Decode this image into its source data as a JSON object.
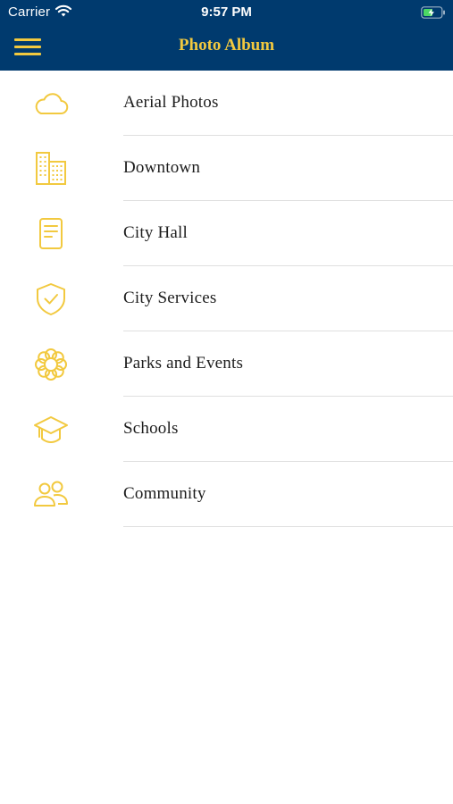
{
  "status_bar": {
    "carrier": "Carrier",
    "time": "9:57 PM",
    "wifi_icon": "wifi-icon",
    "battery_icon": "battery-charging-icon"
  },
  "nav": {
    "title": "Photo Album",
    "menu_icon": "hamburger-menu-icon"
  },
  "colors": {
    "nav_background": "#003a6e",
    "accent": "#f2c93f",
    "divider": "#dfdfdf",
    "text": "#1d1d1d"
  },
  "items": [
    {
      "label": "Aerial Photos",
      "icon": "cloud-icon"
    },
    {
      "label": "Downtown",
      "icon": "building-icon"
    },
    {
      "label": "City Hall",
      "icon": "document-icon"
    },
    {
      "label": "City Services",
      "icon": "shield-check-icon"
    },
    {
      "label": "Parks and Events",
      "icon": "flower-icon"
    },
    {
      "label": "Schools",
      "icon": "graduation-cap-icon"
    },
    {
      "label": "Community",
      "icon": "people-icon"
    }
  ]
}
